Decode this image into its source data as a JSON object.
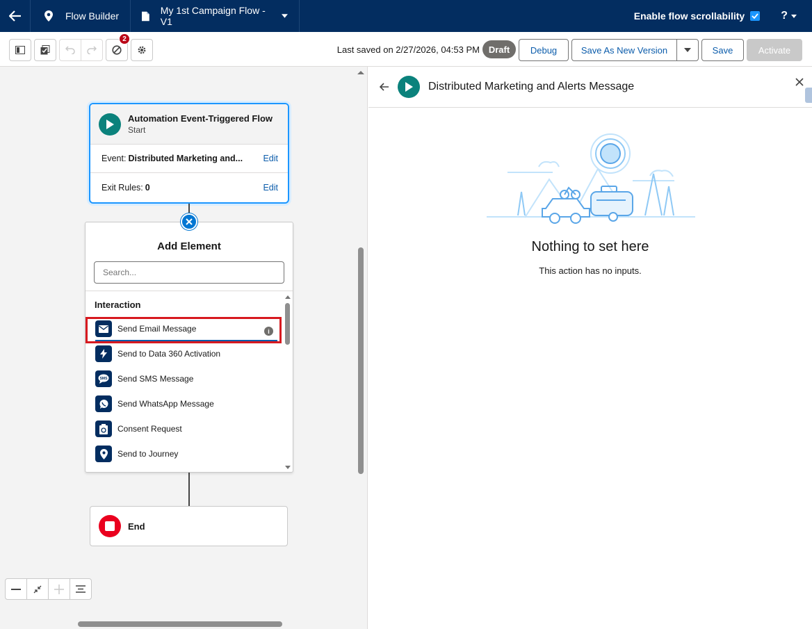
{
  "topbar": {
    "app_name": "Flow Builder",
    "flow_name": "My 1st Campaign Flow - V1",
    "scroll_label": "Enable flow scrollability",
    "help_label": "?"
  },
  "toolbar": {
    "error_count": "2",
    "last_saved": "Last saved on 2/27/2026, 04:53 PM",
    "status": "Draft",
    "debug": "Debug",
    "save_as_new": "Save As New Version",
    "save": "Save",
    "activate": "Activate"
  },
  "start_card": {
    "title": "Automation Event-Triggered Flow",
    "subtitle": "Start",
    "event_label": "Event:",
    "event_value": "Distributed Marketing and...",
    "exit_label": "Exit Rules:",
    "exit_value": "0",
    "edit": "Edit"
  },
  "add_element": {
    "title": "Add Element",
    "search_placeholder": "Search...",
    "section": "Interaction",
    "items": [
      {
        "label": "Send Email Message",
        "icon": "email-icon"
      },
      {
        "label": "Send to Data 360 Activation",
        "icon": "lightning-icon"
      },
      {
        "label": "Send SMS Message",
        "icon": "sms-icon"
      },
      {
        "label": "Send WhatsApp Message",
        "icon": "whatsapp-icon"
      },
      {
        "label": "Consent Request",
        "icon": "consent-icon"
      },
      {
        "label": "Send to Journey",
        "icon": "location-pin-icon"
      }
    ]
  },
  "end_card": {
    "label": "End"
  },
  "panel": {
    "title": "Distributed Marketing and Alerts Message",
    "empty_title": "Nothing to set here",
    "empty_sub": "This action has no inputs."
  },
  "colors": {
    "nav": "#032d60",
    "accent": "#0176d3",
    "start": "#0b827c",
    "end": "#ea001e",
    "highlight": "#d7191f"
  }
}
